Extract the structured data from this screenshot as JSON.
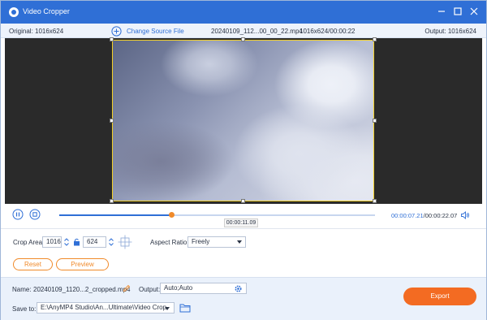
{
  "window": {
    "title": "Video Cropper"
  },
  "infobar": {
    "original": "Original: 1016x624",
    "change_source": "Change Source File",
    "filename": "20240109_112...00_00_22.mp4",
    "dims_duration": "1016x624/00:00:22",
    "output": "Output: 1016x624"
  },
  "playback": {
    "current_time": "00:00:07.21",
    "separator": "/",
    "total_time": "00:00:22.07",
    "hover_time": "00:00:11.09",
    "progress_fraction": 0.355
  },
  "crop": {
    "area_label": "Crop Area:",
    "width": "1016",
    "height": "624",
    "aspect_label": "Aspect Ratio:",
    "aspect_value": "Freely",
    "reset_label": "Reset",
    "preview_label": "Preview"
  },
  "output": {
    "name_label": "Name:",
    "name_value": "20240109_1120...2_cropped.mp4",
    "output_label": "Output:",
    "output_value": "Auto;Auto",
    "save_label": "Save to:",
    "save_path": "E:\\AnyMP4 Studio\\An...Ultimate\\Video Crop",
    "export_label": "Export"
  },
  "colors": {
    "accent_blue": "#2f6fd6",
    "accent_orange": "#f36b22",
    "crop_border": "#f2d02a"
  },
  "icons": [
    "app-logo-icon",
    "minimize-icon",
    "maximize-icon",
    "close-icon",
    "plus-circle-icon",
    "pause-icon",
    "stop-icon",
    "volume-icon",
    "lock-icon",
    "center-crosshair-icon",
    "edit-pencil-icon",
    "gear-icon",
    "chevron-down-icon",
    "folder-icon"
  ]
}
